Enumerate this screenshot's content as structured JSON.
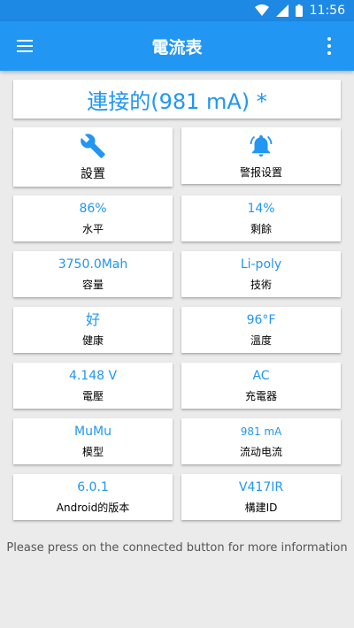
{
  "status_bar": {
    "time": "11:56"
  },
  "app_bar": {
    "title": "電流表"
  },
  "connection": {
    "status": "連接的(981 mA) *"
  },
  "buttons": {
    "settings_label": "設置",
    "alarm_label": "警报设置"
  },
  "tiles": [
    {
      "value": "86%",
      "label": "水平"
    },
    {
      "value": "14%",
      "label": "剩餘"
    },
    {
      "value": "3750.0Mah",
      "label": "容量"
    },
    {
      "value": "Li-poly",
      "label": "技術"
    },
    {
      "value": "好",
      "label": "健康"
    },
    {
      "value": "96°F",
      "label": "溫度"
    },
    {
      "value": "4.148 V",
      "label": "電壓"
    },
    {
      "value": "AC",
      "label": "充電器"
    },
    {
      "value": "MuMu",
      "label": "模型"
    },
    {
      "value": "981 mA",
      "label": "流动电流"
    },
    {
      "value": "6.0.1",
      "label": "Android的版本"
    },
    {
      "value": "V417IR",
      "label": "構建ID"
    }
  ],
  "footer": {
    "text": "Please press on the connected button for more information"
  },
  "colors": {
    "primary": "#2196f3",
    "status_bar": "#1e88e5",
    "background": "#ebebeb"
  }
}
